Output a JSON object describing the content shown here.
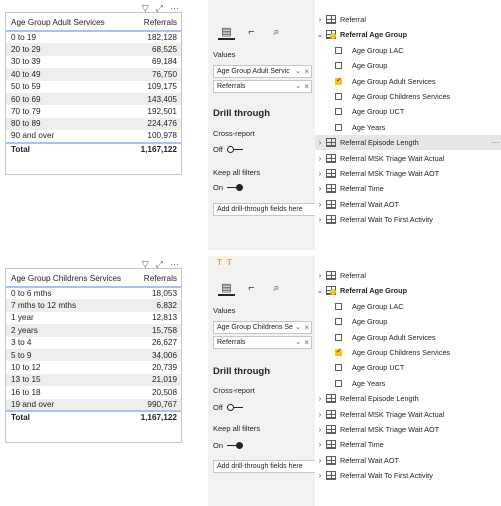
{
  "visual_icons": {
    "filter": "filter-icon",
    "focus": "focus-mode-icon",
    "more": "more-options-icon"
  },
  "adult": {
    "table": {
      "headers": [
        "Age Group Adult Services",
        "Referrals"
      ],
      "rows": [
        [
          "0 to 19",
          "182,128"
        ],
        [
          "20 to 29",
          "68,525"
        ],
        [
          "30 to 39",
          "69,184"
        ],
        [
          "40 to 49",
          "76,750"
        ],
        [
          "50 to 59",
          "109,175"
        ],
        [
          "60 to 69",
          "143,405"
        ],
        [
          "70 to 79",
          "192,501"
        ],
        [
          "80 to 89",
          "224,476"
        ],
        [
          "90 and over",
          "100,978"
        ]
      ],
      "total": [
        "Total",
        "1,167,122"
      ]
    },
    "pane": {
      "values_label": "Values",
      "wells": [
        "Age Group Adult Servic",
        "Referrals"
      ],
      "drill_title": "Drill through",
      "cross_report_label": "Cross-report",
      "cross_report_state": "Off",
      "keep_filters_label": "Keep all filters",
      "keep_filters_state": "On",
      "add_fields": "Add drill-through fields here"
    },
    "fields": {
      "referral": "Referral",
      "group": "Referral Age Group",
      "children": [
        {
          "label": "Age Group LAC",
          "checked": false
        },
        {
          "label": "Age Group",
          "checked": false
        },
        {
          "label": "Age Group Adult Services",
          "checked": true
        },
        {
          "label": "Age Group Childrens Services",
          "checked": false
        },
        {
          "label": "Age Group UCT",
          "checked": false
        },
        {
          "label": "Age Years",
          "checked": false
        }
      ],
      "after": [
        "Referral Episode Length",
        "Referral MSK Triage Wait Actual",
        "Referral MSK Triage Wait AOT",
        "Referral Time",
        "Referral Wait AOT",
        "Referral Wait To First Activity"
      ]
    }
  },
  "child": {
    "table": {
      "headers": [
        "Age Group Childrens Services",
        "Referrals"
      ],
      "rows": [
        [
          "0 to 6 mths",
          "18,053"
        ],
        [
          "7 mths to 12 mths",
          "6,832"
        ],
        [
          "1 year",
          "12,813"
        ],
        [
          "2 years",
          "15,758"
        ],
        [
          "3 to 4",
          "26,627"
        ],
        [
          "5 to 9",
          "34,006"
        ],
        [
          "10 to 12",
          "20,739"
        ],
        [
          "13 to 15",
          "21,019"
        ],
        [
          "16 to 18",
          "20,508"
        ],
        [
          "19 and over",
          "990,767"
        ]
      ],
      "total": [
        "Total",
        "1,167,122"
      ]
    },
    "pane": {
      "values_label": "Values",
      "wells": [
        "Age Group Childrens Se",
        "Referrals"
      ],
      "drill_title": "Drill through",
      "cross_report_label": "Cross-report",
      "cross_report_state": "Off",
      "keep_filters_label": "Keep all filters",
      "keep_filters_state": "On",
      "add_fields": "Add drill-through fields here"
    },
    "fields": {
      "referral": "Referral",
      "group": "Referral Age Group",
      "children": [
        {
          "label": "Age Group LAC",
          "checked": false
        },
        {
          "label": "Age Group",
          "checked": false
        },
        {
          "label": "Age Group Adult Services",
          "checked": false
        },
        {
          "label": "Age Group Childrens Services",
          "checked": true
        },
        {
          "label": "Age Group UCT",
          "checked": false
        },
        {
          "label": "Age Years",
          "checked": false
        }
      ],
      "after": [
        "Referral Episode Length",
        "Referral MSK Triage Wait Actual",
        "Referral MSK Triage Wait AOT",
        "Referral Time",
        "Referral Wait AOT",
        "Referral Wait To First Activity"
      ]
    }
  }
}
